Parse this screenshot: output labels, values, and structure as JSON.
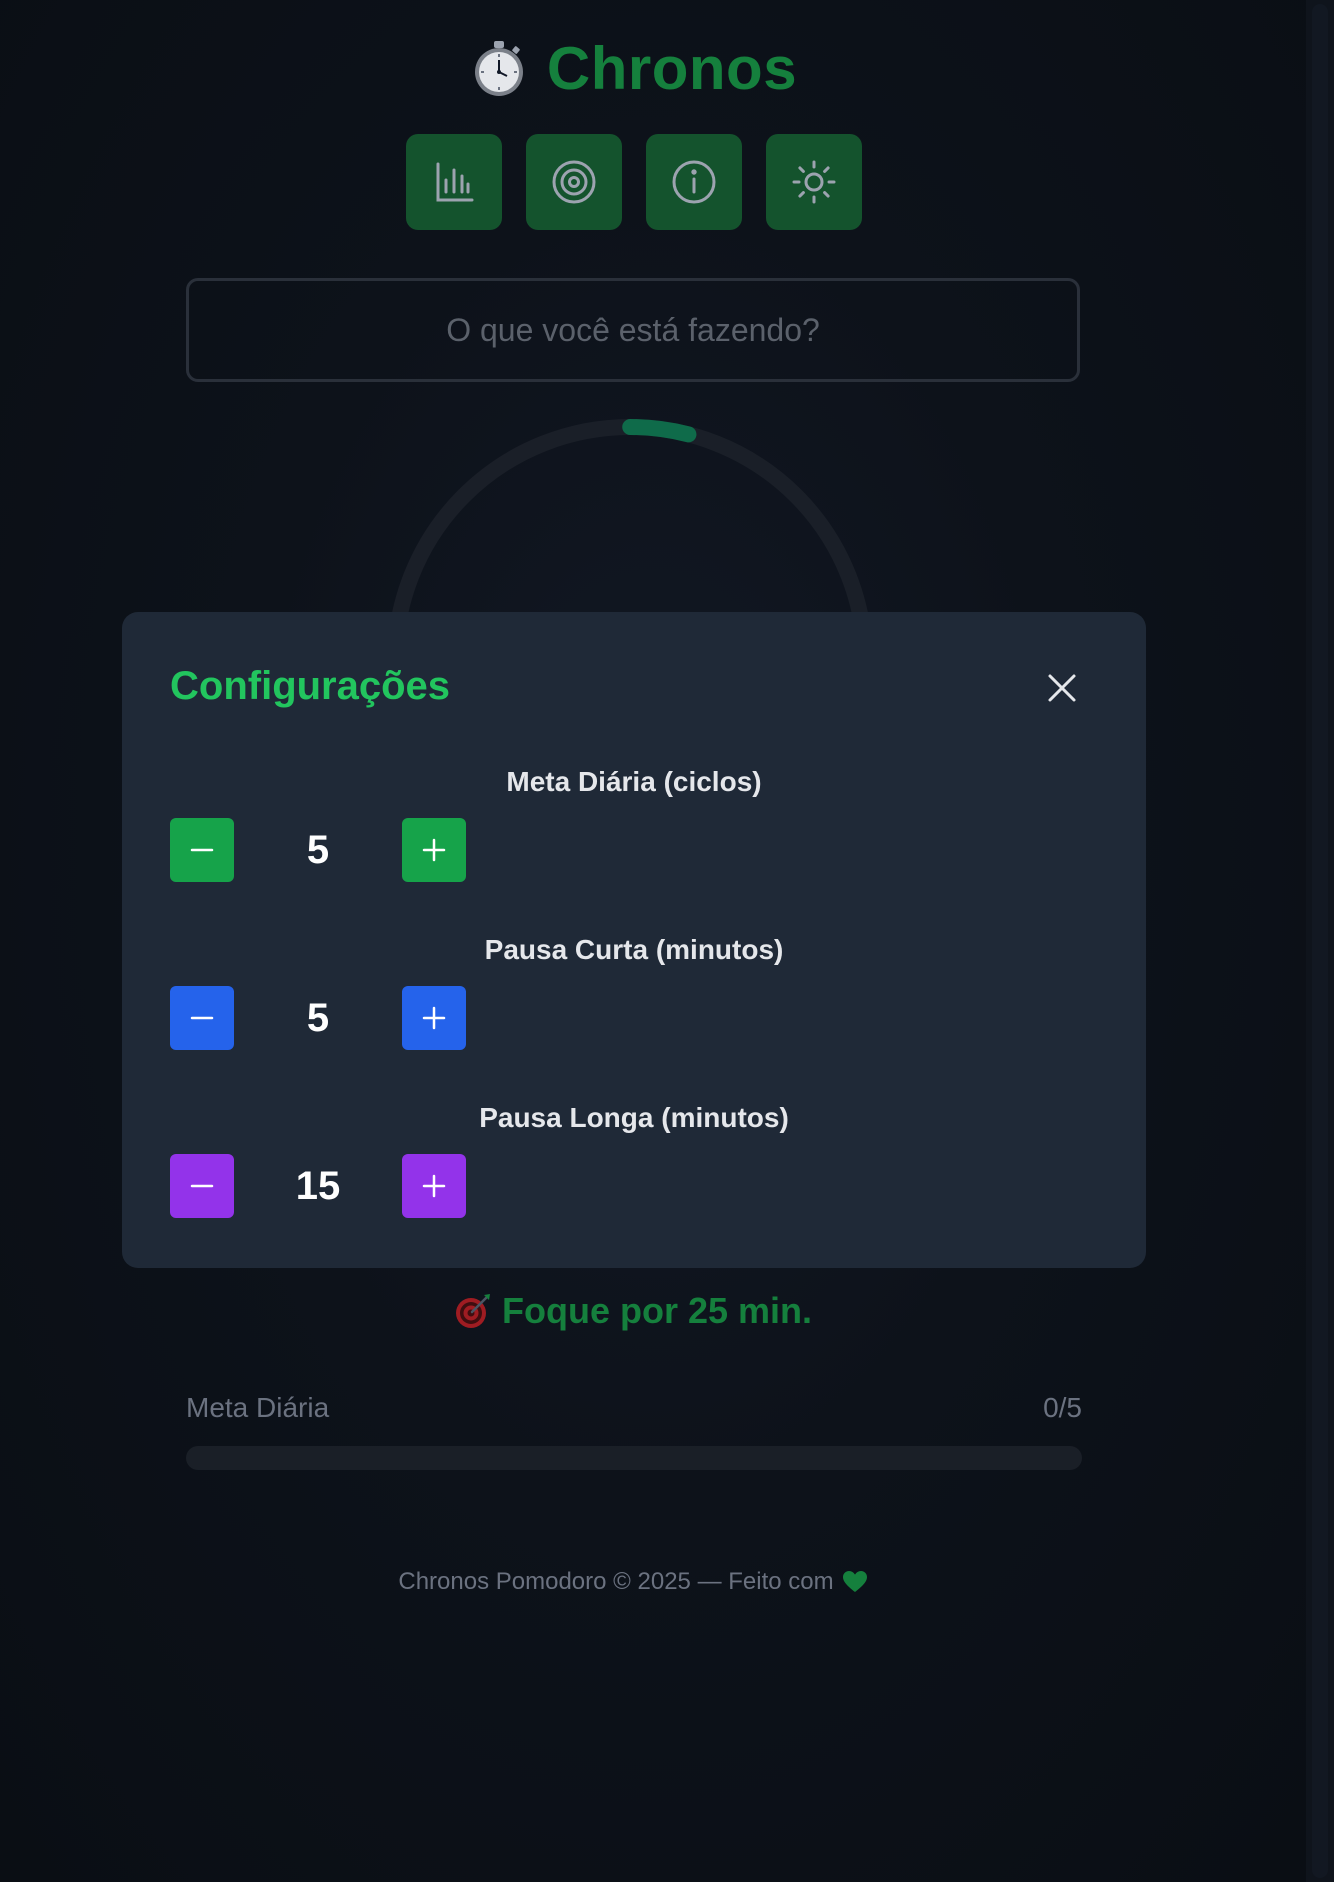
{
  "app": {
    "title": "Chronos",
    "icon": "stopwatch-icon",
    "accent_color": "#15803d"
  },
  "toolbar": {
    "buttons": [
      {
        "icon": "bar-chart-icon",
        "name": "stats"
      },
      {
        "icon": "target-icon",
        "name": "goals"
      },
      {
        "icon": "info-icon",
        "name": "info"
      },
      {
        "icon": "sun-icon",
        "name": "theme"
      }
    ]
  },
  "task": {
    "placeholder": "O que você está fazendo?",
    "value": ""
  },
  "timer": {
    "progress_fraction": 0.04
  },
  "settings_modal": {
    "title": "Configurações",
    "close_icon": "close-icon",
    "settings": [
      {
        "label": "Meta Diária (ciclos)",
        "value": "5",
        "color": "#16a34a"
      },
      {
        "label": "Pausa Curta (minutos)",
        "value": "5",
        "color": "#2563eb"
      },
      {
        "label": "Pausa Longa (minutos)",
        "value": "15",
        "color": "#9333ea"
      }
    ]
  },
  "focus": {
    "icon": "bullseye-icon",
    "text": "Foque por 25 min."
  },
  "daily_goal": {
    "label": "Meta Diária",
    "count": "0/5",
    "progress_fraction": 0
  },
  "footer": {
    "text": "Chronos Pomodoro © 2025 — Feito com",
    "icon": "green-heart-icon"
  }
}
